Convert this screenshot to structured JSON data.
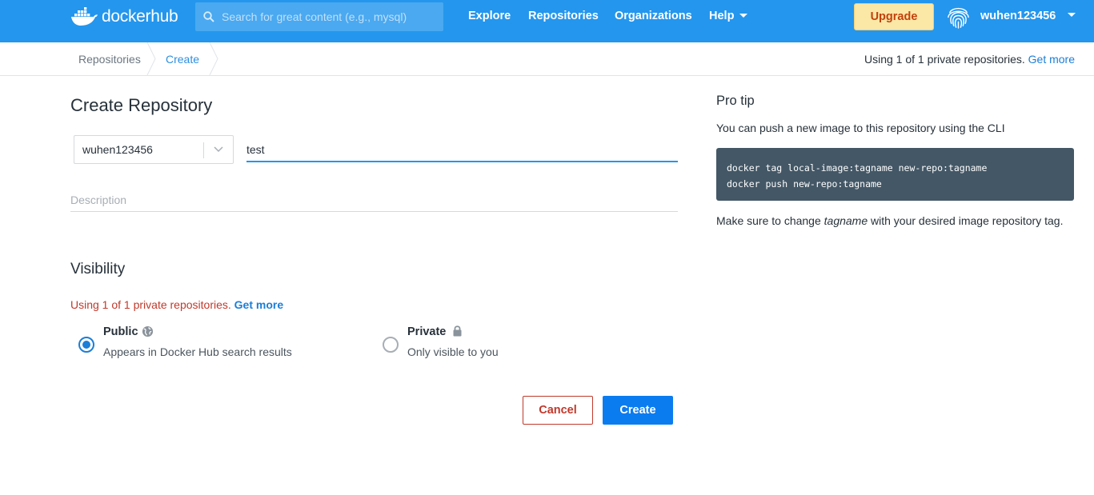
{
  "header": {
    "logo_text_bold": "docker",
    "logo_text": "hub",
    "search_placeholder": "Search for great content (e.g., mysql)",
    "nav": {
      "explore": "Explore",
      "repositories": "Repositories",
      "organizations": "Organizations",
      "help": "Help"
    },
    "upgrade_label": "Upgrade",
    "username": "wuhen123456"
  },
  "breadcrumb": {
    "items": [
      "Repositories",
      "Create"
    ],
    "usage_text": "Using 1 of 1 private repositories.",
    "usage_link": "Get more"
  },
  "form": {
    "title": "Create Repository",
    "namespace": "wuhen123456",
    "name_value": "test",
    "description_placeholder": "Description",
    "visibility_title": "Visibility",
    "visibility_warning": "Using 1 of 1 private repositories.",
    "visibility_warning_link": "Get more",
    "options": [
      {
        "title": "Public",
        "description": "Appears in Docker Hub search results",
        "selected": true,
        "icon": "globe-icon"
      },
      {
        "title": "Private",
        "description": "Only visible to you",
        "selected": false,
        "icon": "lock-icon"
      }
    ],
    "cancel_label": "Cancel",
    "create_label": "Create"
  },
  "pro_tip": {
    "title": "Pro tip",
    "text": "You can push a new image to this repository using the CLI",
    "code_lines": [
      "docker tag local-image:tagname new-repo:tagname",
      "docker push new-repo:tagname"
    ],
    "note_before": "Make sure to change ",
    "note_em": "tagname",
    "note_after": " with your desired image repository tag."
  },
  "colors": {
    "brand_blue": "#2496ed",
    "primary_button": "#0b7cf0",
    "danger": "#c0392b",
    "upgrade_bg": "#fbe7a6",
    "code_bg": "#435766"
  }
}
